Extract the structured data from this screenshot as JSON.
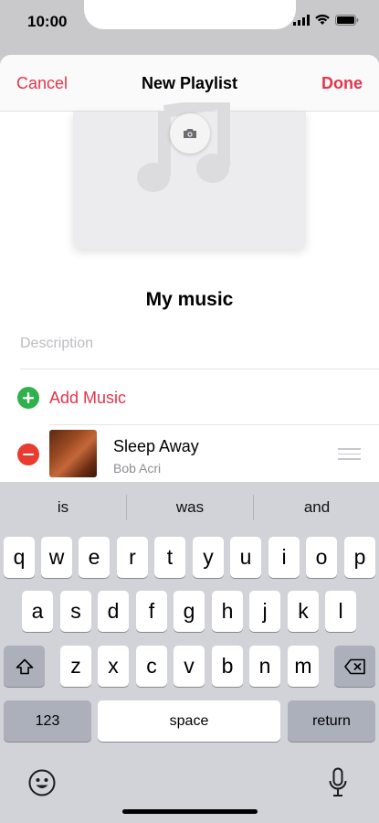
{
  "status": {
    "time": "10:00"
  },
  "nav": {
    "cancel": "Cancel",
    "title": "New Playlist",
    "done": "Done"
  },
  "playlist": {
    "name": "My music",
    "description_placeholder": "Description"
  },
  "add_music": {
    "label": "Add Music"
  },
  "songs": [
    {
      "title": "Sleep Away",
      "artist": "Bob Acri"
    }
  ],
  "keyboard": {
    "suggestions": [
      "is",
      "was",
      "and"
    ],
    "row1": [
      "q",
      "w",
      "e",
      "r",
      "t",
      "y",
      "u",
      "i",
      "o",
      "p"
    ],
    "row2": [
      "a",
      "s",
      "d",
      "f",
      "g",
      "h",
      "j",
      "k",
      "l"
    ],
    "row3": [
      "z",
      "x",
      "c",
      "v",
      "b",
      "n",
      "m"
    ],
    "numbers": "123",
    "space": "space",
    "return": "return"
  },
  "colors": {
    "accent": "#e7334a",
    "add": "#2fb14d",
    "remove": "#ea3b30"
  }
}
